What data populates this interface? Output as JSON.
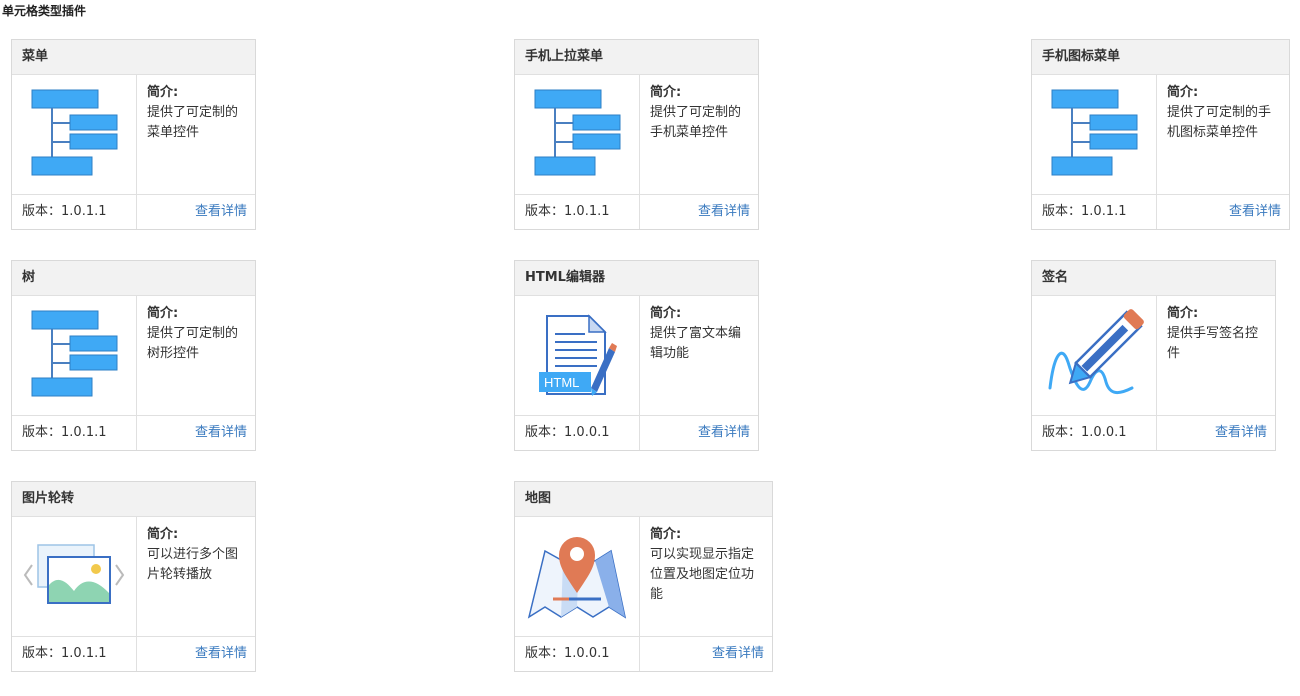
{
  "page": {
    "title": "单元格类型插件"
  },
  "desc_label": "简介:",
  "version_label": "版本：",
  "link_label": "查看详情",
  "cards": [
    {
      "title": "菜单",
      "desc": "提供了可定制的菜单控件",
      "version": "1.0.1.1",
      "icon": "menu-tree-icon"
    },
    {
      "title": "手机上拉菜单",
      "desc": "提供了可定制的手机菜单控件",
      "version": "1.0.1.1",
      "icon": "menu-tree-icon"
    },
    {
      "title": "手机图标菜单",
      "desc": "提供了可定制的手机图标菜单控件",
      "version": "1.0.1.1",
      "icon": "menu-tree-icon"
    },
    {
      "title": "树",
      "desc": "提供了可定制的树形控件",
      "version": "1.0.1.1",
      "icon": "menu-tree-icon"
    },
    {
      "title": "HTML编辑器",
      "desc": "提供了富文本编辑功能",
      "version": "1.0.0.1",
      "icon": "html-editor-icon",
      "icon_text": "HTML"
    },
    {
      "title": "签名",
      "desc": "提供手写签名控件",
      "version": "1.0.0.1",
      "icon": "signature-pen-icon"
    },
    {
      "title": "图片轮转",
      "desc": "可以进行多个图片轮转播放",
      "version": "1.0.1.1",
      "icon": "image-carousel-icon"
    },
    {
      "title": "地图",
      "desc": "可以实现显示指定位置及地图定位功能",
      "version": "1.0.0.1",
      "icon": "map-pin-icon"
    }
  ],
  "colors": {
    "accent_blue": "#3fa9f5",
    "link": "#3a7abf",
    "pin_orange": "#e07a55"
  }
}
